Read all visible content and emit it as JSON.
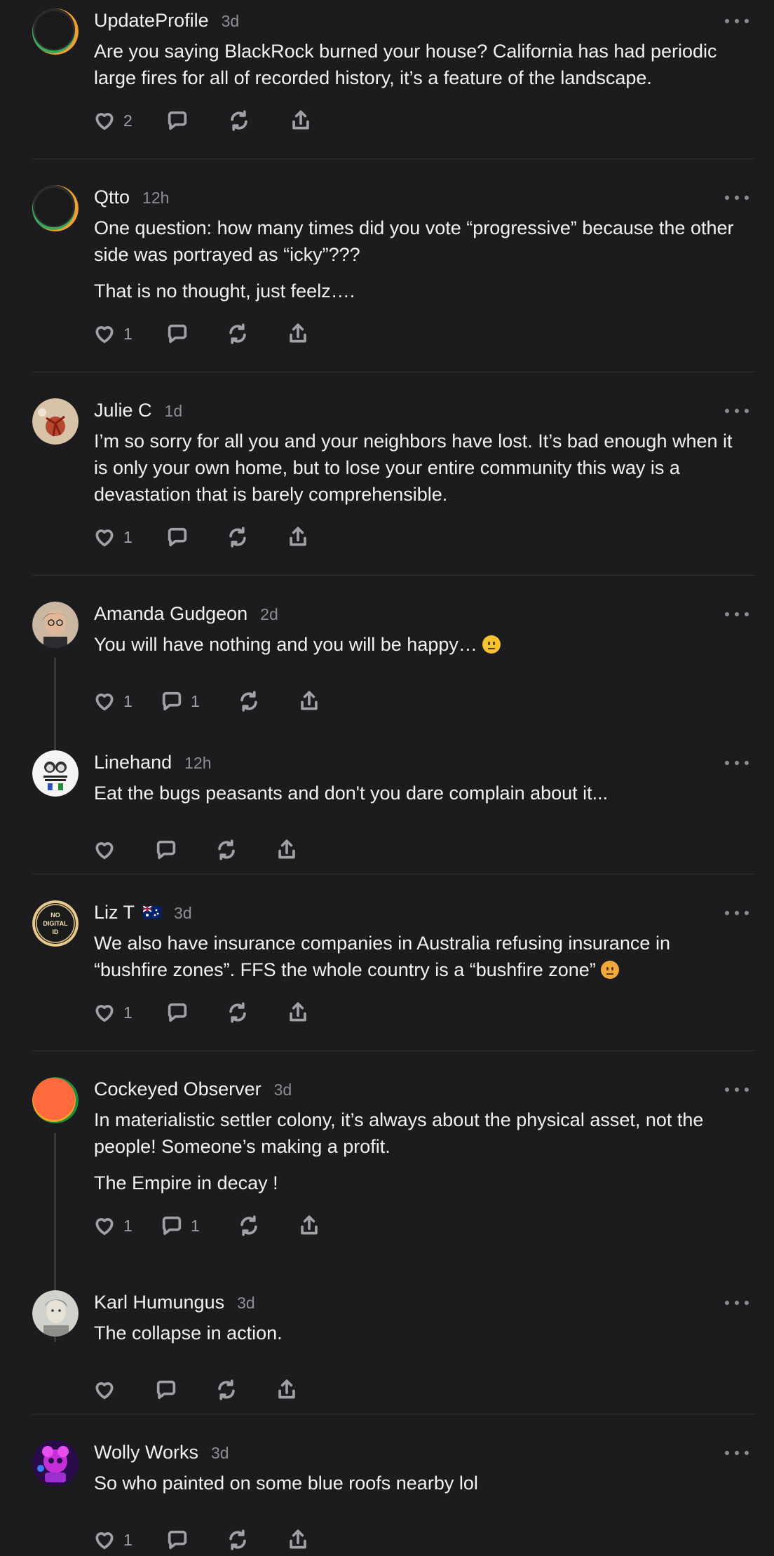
{
  "comments": [
    {
      "author": "UpdateProfile",
      "time": "3d",
      "paragraphs": [
        "Are you saying BlackRock burned your house? California has had periodic large fires for all of recorded history, it’s a feature of the landscape."
      ],
      "likes": "2",
      "replies": "",
      "avatar": "avatar-default"
    },
    {
      "author": "Qtto",
      "time": "12h",
      "paragraphs": [
        "One question: how many times did you vote “progressive” because the other side was portrayed as “icky”???",
        "That is no thought, just feelz…."
      ],
      "likes": "1",
      "replies": "",
      "avatar": "avatar-default"
    },
    {
      "author": "Julie C",
      "time": "1d",
      "paragraphs": [
        "I’m so sorry for all you and your neighbors have lost. It’s bad enough when it is only your own home, but to lose your entire community this way is a devastation that is barely comprehensible."
      ],
      "likes": "1",
      "replies": "",
      "avatar": "avatar-photo"
    },
    {
      "author": "Amanda Gudgeon",
      "time": "2d",
      "paragraphs": [
        "You will have nothing and you will be happy…"
      ],
      "likes": "1",
      "replies": "1",
      "avatar": "avatar-photo"
    },
    {
      "author": "Linehand",
      "time": "12h",
      "paragraphs": [
        "Eat the bugs peasants and don't you dare complain about it..."
      ],
      "likes": "",
      "replies": "",
      "avatar": "avatar-poster",
      "avatar_text": "WE HAVE A RIGHT TO EXIST"
    },
    {
      "author": "Liz T",
      "flag": "🇦🇺",
      "time": "3d",
      "paragraphs": [
        "We also have insurance companies in Australia refusing insurance in “bushfire zones”. FFS the whole country is a “bushfire zone”"
      ],
      "likes": "1",
      "replies": "",
      "avatar": "avatar-badge",
      "avatar_text": "NO DIGITAL ID"
    },
    {
      "author": "Cockeyed Observer",
      "time": "3d",
      "paragraphs": [
        "In materialistic settler colony, it’s always about the physical asset, not the people! Someone’s making a profit.",
        "The Empire in decay !"
      ],
      "likes": "1",
      "replies": "1",
      "avatar": "avatar-orange"
    },
    {
      "author": "Karl Humungus",
      "time": "3d",
      "paragraphs": [
        "The collapse in action."
      ],
      "likes": "",
      "replies": "",
      "avatar": "avatar-photo"
    },
    {
      "author": "Wolly Works",
      "time": "3d",
      "paragraphs": [
        "So who painted on some blue roofs nearby lol"
      ],
      "likes": "1",
      "replies": "",
      "avatar": "avatar-art"
    }
  ],
  "icons": {
    "like": "heart-icon",
    "reply": "comment-icon",
    "restack": "restack-icon",
    "share": "share-icon",
    "more": "more-icon"
  },
  "colors": {
    "background": "#1c1c1e",
    "text": "#f2f2f2",
    "muted": "#8e8e93",
    "divider": "#2f2f32"
  }
}
